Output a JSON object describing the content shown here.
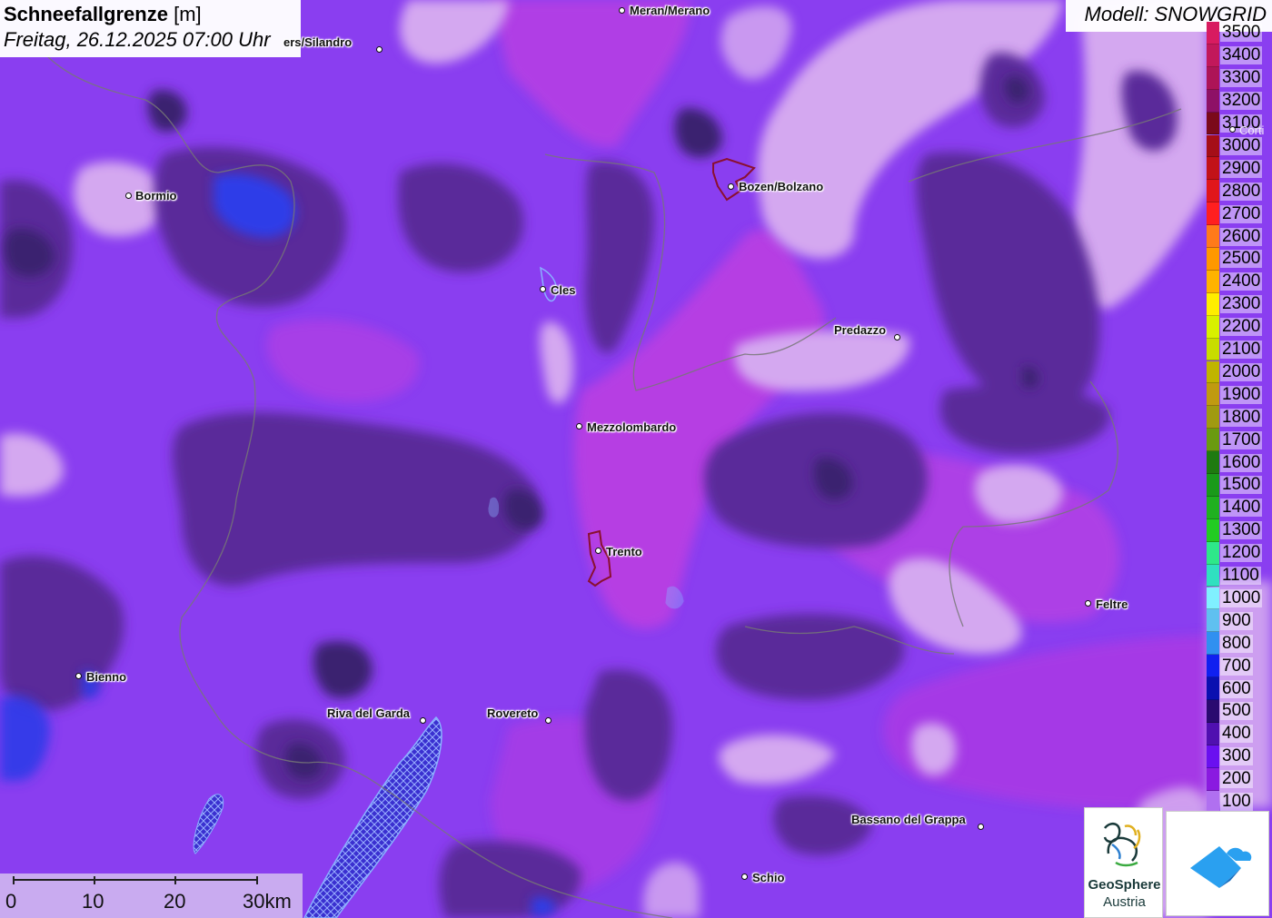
{
  "title": {
    "name": "Schneefallgrenze",
    "unit": "[m]",
    "datetime": "Freitag, 26.12.2025 07:00 Uhr"
  },
  "model": "Modell: SNOWGRID",
  "legend": [
    {
      "label": "3500",
      "color": "#d81b60"
    },
    {
      "label": "3400",
      "color": "#c2185b"
    },
    {
      "label": "3300",
      "color": "#ad1457"
    },
    {
      "label": "3200",
      "color": "#8e1166"
    },
    {
      "label": "3100",
      "color": "#7b0a1a"
    },
    {
      "label": "3000",
      "color": "#a50e18"
    },
    {
      "label": "2900",
      "color": "#c21219"
    },
    {
      "label": "2800",
      "color": "#e0161b"
    },
    {
      "label": "2700",
      "color": "#ff1f1f"
    },
    {
      "label": "2600",
      "color": "#ff7a1a"
    },
    {
      "label": "2500",
      "color": "#ff9800"
    },
    {
      "label": "2400",
      "color": "#ffb300"
    },
    {
      "label": "2300",
      "color": "#ffee00"
    },
    {
      "label": "2200",
      "color": "#d8f000"
    },
    {
      "label": "2100",
      "color": "#c8dc00"
    },
    {
      "label": "2000",
      "color": "#c0b400"
    },
    {
      "label": "1900",
      "color": "#c09a10"
    },
    {
      "label": "1800",
      "color": "#a09a10"
    },
    {
      "label": "1700",
      "color": "#6a9a10"
    },
    {
      "label": "1600",
      "color": "#1f7a10"
    },
    {
      "label": "1500",
      "color": "#1a9a1a"
    },
    {
      "label": "1400",
      "color": "#20b020"
    },
    {
      "label": "1300",
      "color": "#22cc22"
    },
    {
      "label": "1200",
      "color": "#2ee88a"
    },
    {
      "label": "1100",
      "color": "#30e0c0"
    },
    {
      "label": "1000",
      "color": "#80f0ff"
    },
    {
      "label": "900",
      "color": "#60c0f0"
    },
    {
      "label": "800",
      "color": "#3090f0"
    },
    {
      "label": "700",
      "color": "#1020f0"
    },
    {
      "label": "600",
      "color": "#0a10b0"
    },
    {
      "label": "500",
      "color": "#2a0a70"
    },
    {
      "label": "400",
      "color": "#5010b0"
    },
    {
      "label": "300",
      "color": "#6a10f0"
    },
    {
      "label": "200",
      "color": "#8a1ae0"
    },
    {
      "label": "100",
      "color": "#b070f0"
    }
  ],
  "cities": [
    {
      "name": "Meran/Merano"
    },
    {
      "name": "ers/Silandro"
    },
    {
      "name": "Bormio"
    },
    {
      "name": "Bozen/Bolzano"
    },
    {
      "name": "Cles"
    },
    {
      "name": "Predazzo"
    },
    {
      "name": "Mezzolombardo"
    },
    {
      "name": "Trento"
    },
    {
      "name": "Feltre"
    },
    {
      "name": "Bienno"
    },
    {
      "name": "Riva del Garda"
    },
    {
      "name": "Rovereto"
    },
    {
      "name": "Bassano del Grappa"
    },
    {
      "name": "Schio"
    },
    {
      "name": "Corti"
    }
  ],
  "scale": {
    "labels": [
      "0",
      "10",
      "20",
      "30km"
    ]
  },
  "logos": {
    "geosphere_line1": "GeoSphere",
    "geosphere_line2": "Austria"
  },
  "colors": {
    "base": "#8a3ef0",
    "light": "#d4a8f0",
    "mid": "#7a28e0",
    "dark": "#5a2a9a",
    "darker": "#3a2070",
    "magenta": "#c040e0",
    "blue": "#2040e0"
  }
}
